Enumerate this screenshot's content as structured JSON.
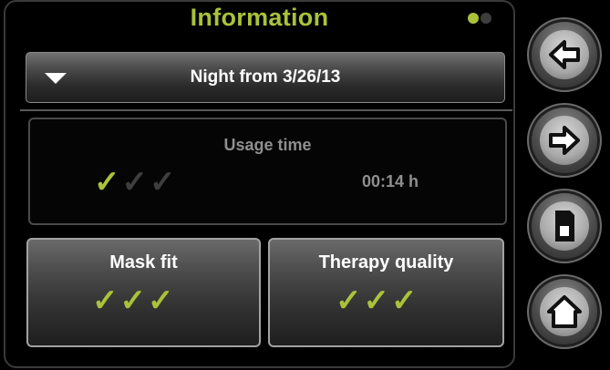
{
  "header": {
    "title": "Information",
    "page_indicator": {
      "current": 1,
      "total": 2
    },
    "active_color": "#a9c23a"
  },
  "night_selector": {
    "label": "Night from 3/26/13",
    "icon": "dropdown-triangle-icon"
  },
  "usage": {
    "title": "Usage time",
    "value": "00:14 h",
    "rating": 1,
    "max_rating": 3
  },
  "mask_fit": {
    "title": "Mask fit",
    "rating": 3,
    "max_rating": 3
  },
  "therapy_quality": {
    "title": "Therapy quality",
    "rating": 3,
    "max_rating": 3
  },
  "nav": {
    "back_icon": "arrow-left-icon",
    "forward_icon": "arrow-right-icon",
    "sd_card_icon": "sd-card-icon",
    "home_icon": "home-icon"
  }
}
